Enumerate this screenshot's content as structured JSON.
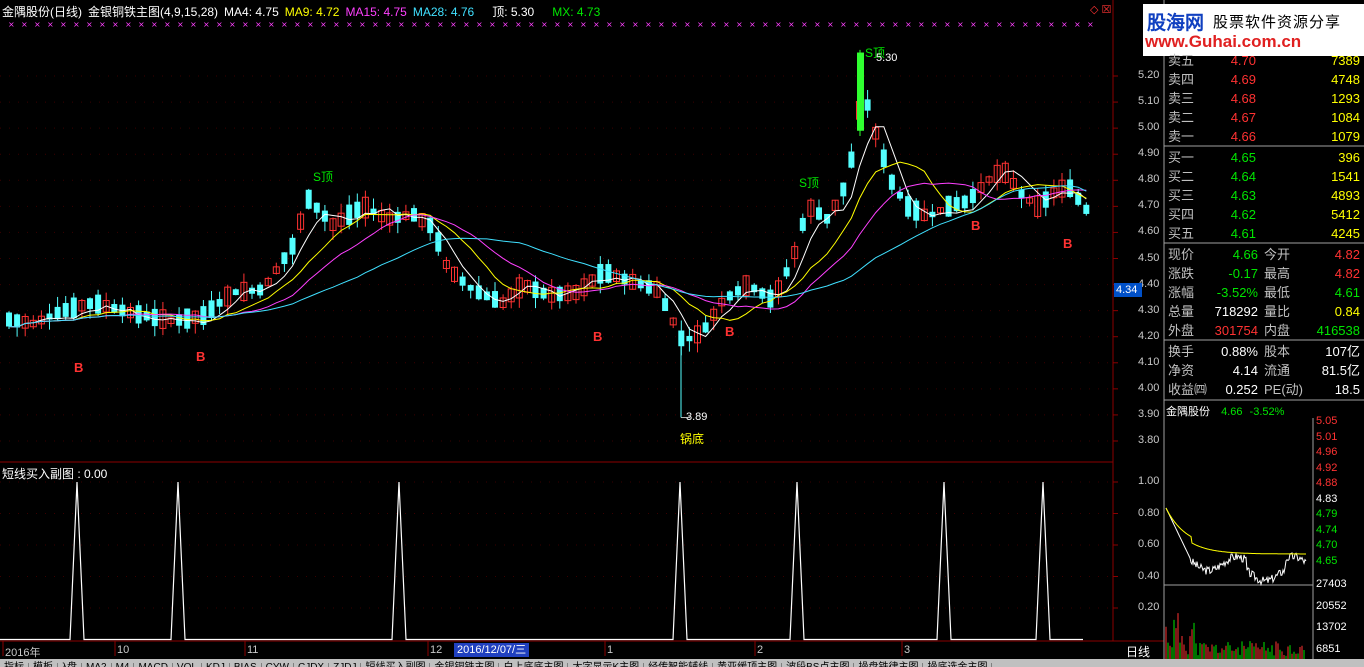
{
  "main_title": {
    "name": "金隅股份(日线)",
    "indicator": "金银铜铁主图(4,9,15,28)",
    "ma4_label": "MA4: 4.75",
    "ma9_label": "MA9: 4.72",
    "ma15_label": "MA15: 4.75",
    "ma28_label": "MA28: 4.76",
    "top_label": "顶: 5.30",
    "mx_label": "MX: 4.73"
  },
  "colors": {
    "up": "#ff3232",
    "down": "#54ffff",
    "ma4": "#ffffff",
    "ma9": "#ffff00",
    "ma15": "#ff40ff",
    "ma28": "#40e0ff",
    "grid": "#8b0000"
  },
  "annotations": {
    "peak_label": "5.30",
    "peak_tag": "S顶",
    "low_label": "3.89",
    "low_tag": "锅底",
    "top_tag1": "S顶",
    "top_tag2": "S顶",
    "buy_tag": "B"
  },
  "price_axis": [
    "5.20",
    "5.10",
    "5.00",
    "4.90",
    "4.80",
    "4.70",
    "4.60",
    "4.50",
    "4.40",
    "4.30",
    "4.20",
    "4.10",
    "4.00",
    "3.90",
    "3.80"
  ],
  "current_price_marker": "4.34",
  "sub_title": "短线买入副图 : 0.00",
  "sub_axis": [
    "1.00",
    "0.80",
    "0.60",
    "0.40",
    "0.20"
  ],
  "date_axis": {
    "labels": [
      "2016年",
      "10",
      "11",
      "12",
      "1",
      "2",
      "3"
    ],
    "selected": "2016/12/07/三",
    "period_label": "日线"
  },
  "logo": {
    "main": "股海网",
    "slogan": "股票软件资源分享",
    "url": "www.Guhai.com.cn"
  },
  "asks": [
    {
      "label": "卖五",
      "price": "4.70",
      "vol": "7389"
    },
    {
      "label": "卖四",
      "price": "4.69",
      "vol": "4748"
    },
    {
      "label": "卖三",
      "price": "4.68",
      "vol": "1293"
    },
    {
      "label": "卖二",
      "price": "4.67",
      "vol": "1084"
    },
    {
      "label": "卖一",
      "price": "4.66",
      "vol": "1079"
    }
  ],
  "bids": [
    {
      "label": "买一",
      "price": "4.65",
      "vol": "396"
    },
    {
      "label": "买二",
      "price": "4.64",
      "vol": "1541"
    },
    {
      "label": "买三",
      "price": "4.63",
      "vol": "4893"
    },
    {
      "label": "买四",
      "price": "4.62",
      "vol": "5412"
    },
    {
      "label": "买五",
      "price": "4.61",
      "vol": "4245"
    }
  ],
  "info": [
    {
      "l1": "现价",
      "v1": "4.66",
      "c1": "green",
      "l2": "今开",
      "v2": "4.82",
      "c2": "red"
    },
    {
      "l1": "涨跌",
      "v1": "-0.17",
      "c1": "green",
      "l2": "最高",
      "v2": "4.82",
      "c2": "red"
    },
    {
      "l1": "涨幅",
      "v1": "-3.52%",
      "c1": "green",
      "l2": "最低",
      "v2": "4.61",
      "c2": "green"
    },
    {
      "l1": "总量",
      "v1": "718292",
      "c1": "white",
      "l2": "量比",
      "v2": "0.84",
      "c2": "yellow"
    },
    {
      "l1": "外盘",
      "v1": "301754",
      "c1": "red",
      "l2": "内盘",
      "v2": "416538",
      "c2": "green"
    }
  ],
  "info2": [
    {
      "l1": "换手",
      "v1": "0.88%",
      "c1": "white",
      "l2": "股本",
      "v2": "107亿",
      "c2": "white"
    },
    {
      "l1": "净资",
      "v1": "4.14",
      "c1": "white",
      "l2": "流通",
      "v2": "81.5亿",
      "c2": "white"
    },
    {
      "l1": "收益㈣",
      "v1": "0.252",
      "c1": "white",
      "l2": "PE(动)",
      "v2": "18.5",
      "c2": "white"
    }
  ],
  "mini": {
    "name": "金隅股份",
    "price": "4.66",
    "pct": "-3.52%",
    "axis": [
      "5.05",
      "5.01",
      "4.96",
      "4.92",
      "4.88",
      "4.83",
      "4.79",
      "4.74",
      "4.70",
      "4.65"
    ],
    "vol_axis": [
      "27403",
      "20552",
      "13702",
      "6851"
    ]
  },
  "bottom_tabs": [
    "指标",
    "模板",
    "λ盘",
    "MA2",
    "M4",
    "MACD",
    "VOL",
    "KDJ",
    "BIAS",
    "CYW",
    "CJDX",
    "ZJDJ",
    "短线买入副图",
    "金银铜铁主图",
    "白上底底主图",
    "大字显示K主图",
    "经传智能辅线",
    "黄亚缓顶主图",
    "波段BS点主图",
    "操盘铁律主图",
    "操底选金主图"
  ]
}
